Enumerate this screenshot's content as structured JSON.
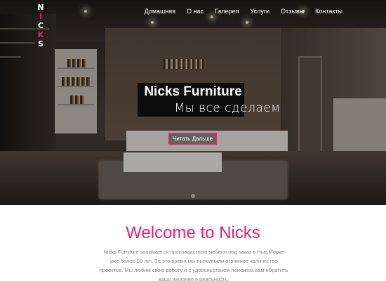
{
  "brand": {
    "logo_letters": [
      "N",
      "I",
      "C",
      "K",
      "S"
    ],
    "accent_color": "#e8226b"
  },
  "nav": {
    "items": [
      {
        "label": "Домашняя"
      },
      {
        "label": "О нас"
      },
      {
        "label": "Галерея"
      },
      {
        "label": "Услуги"
      },
      {
        "label": "Отзывы"
      },
      {
        "label": "Контакты"
      }
    ]
  },
  "hero": {
    "title": "Nicks Furniture",
    "subtitle": "Мы все сделаем",
    "cta_label": "Читать Дальше",
    "cta_border_color": "#e8226b",
    "scroll_icon": "chevron-down-icon"
  },
  "welcome": {
    "title": "Welcome to Nicks",
    "text": "Nicks Furniture занимается производством мебели под заказ в Нью Йорке уже более 10 лет. За это время мы выполнили огромное количество проектов. Мы любим свою работу и с удовольствием поможем вам обратить ваши желания в реальность."
  }
}
